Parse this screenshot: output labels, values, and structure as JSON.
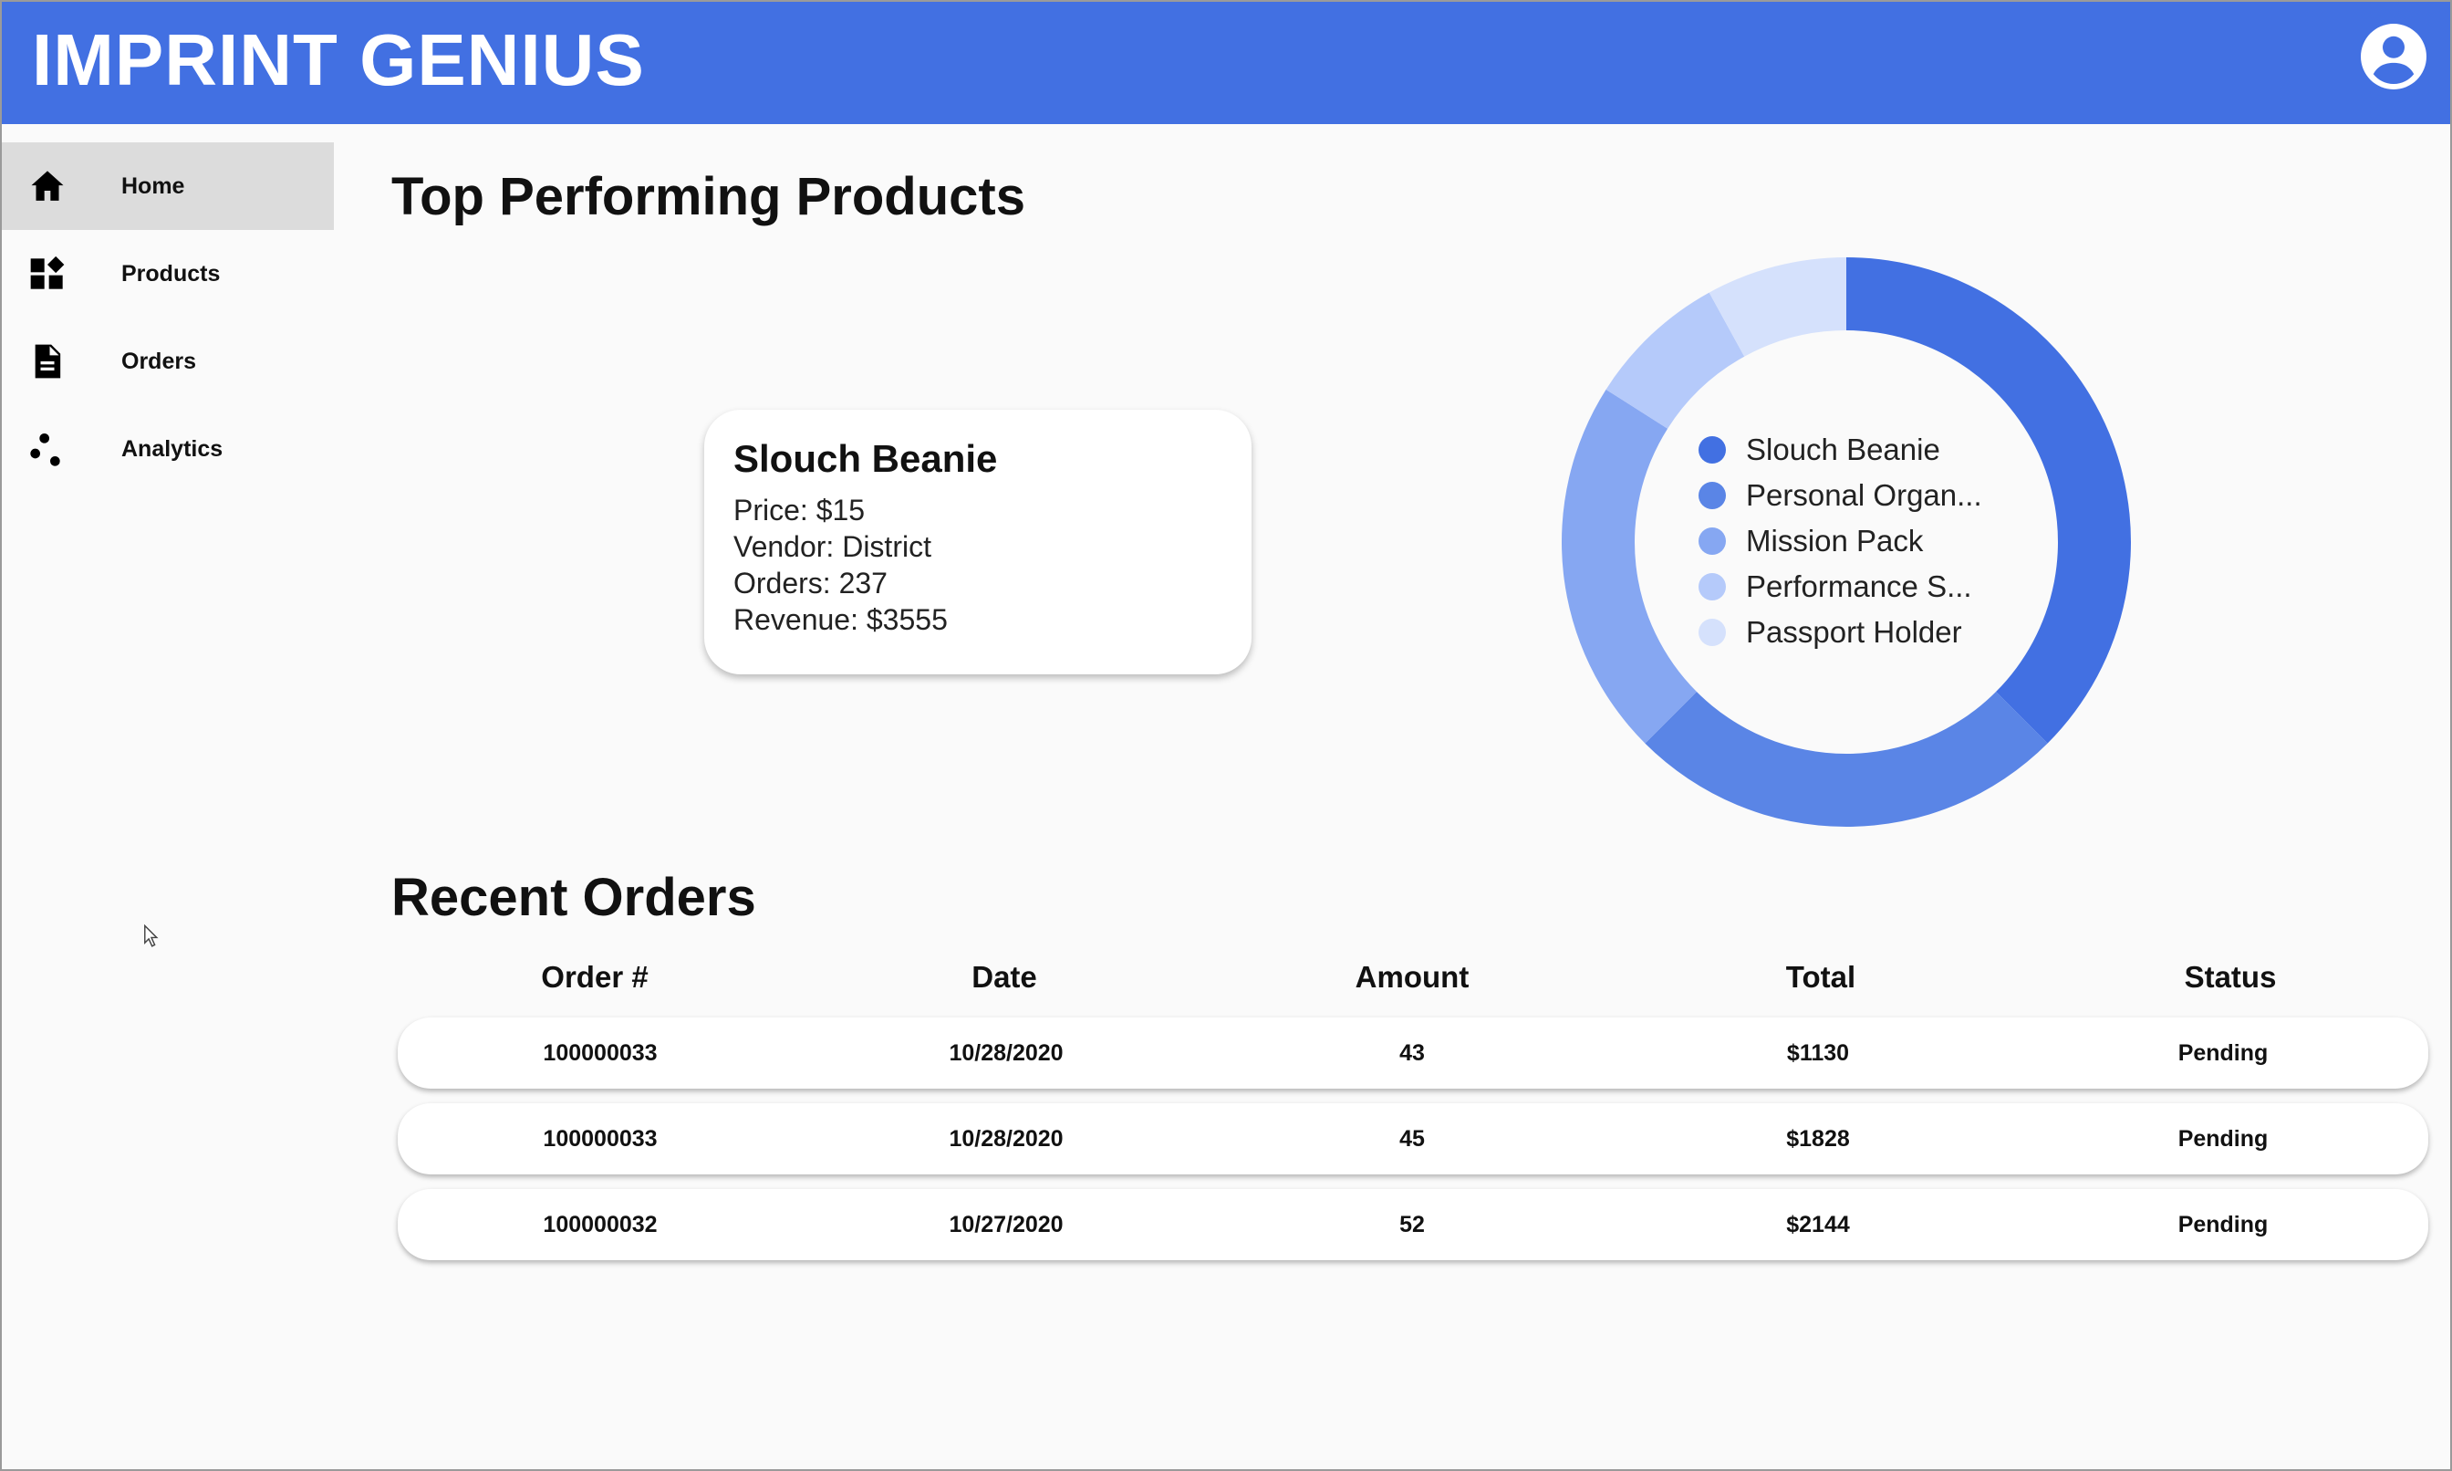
{
  "app": {
    "title": "IMPRINT GENIUS"
  },
  "header": {
    "account_icon": "account-circle-icon"
  },
  "sidebar": {
    "items": [
      {
        "label": "Home",
        "icon": "home-icon",
        "active": true
      },
      {
        "label": "Products",
        "icon": "widgets-icon",
        "active": false
      },
      {
        "label": "Orders",
        "icon": "document-icon",
        "active": false
      },
      {
        "label": "Analytics",
        "icon": "scatter-dots-icon",
        "active": false
      }
    ]
  },
  "top_products": {
    "heading": "Top Performing Products",
    "card": {
      "name": "Slouch Beanie",
      "price": "Price: $15",
      "vendor": "Vendor: District",
      "orders": "Orders: 237",
      "revenue": "Revenue: $3555"
    },
    "legend": [
      {
        "label": "Slouch Beanie",
        "color": "#4270e2"
      },
      {
        "label": "Personal Organ...",
        "color": "#5a85e6"
      },
      {
        "label": "Mission Pack",
        "color": "#86a7f2"
      },
      {
        "label": "Performance S...",
        "color": "#b5cafa"
      },
      {
        "label": "Passport Holder",
        "color": "#d5e1fc"
      }
    ]
  },
  "chart_data": {
    "type": "pie",
    "categories": [
      "Slouch Beanie",
      "Personal Organ...",
      "Mission Pack",
      "Performance S...",
      "Passport Holder"
    ],
    "values": [
      37.5,
      25,
      21.5,
      8,
      8
    ],
    "colors": [
      "#4270e2",
      "#5a85e6",
      "#86a7f2",
      "#b5cafa",
      "#d5e1fc"
    ],
    "legend": "center"
  },
  "recent_orders": {
    "heading": "Recent Orders",
    "columns": [
      "Order #",
      "Date",
      "Amount",
      "Total",
      "Status"
    ],
    "rows": [
      [
        "100000033",
        "10/28/2020",
        "43",
        "$1130",
        "Pending"
      ],
      [
        "100000033",
        "10/28/2020",
        "45",
        "$1828",
        "Pending"
      ],
      [
        "100000032",
        "10/27/2020",
        "52",
        "$2144",
        "Pending"
      ]
    ]
  }
}
